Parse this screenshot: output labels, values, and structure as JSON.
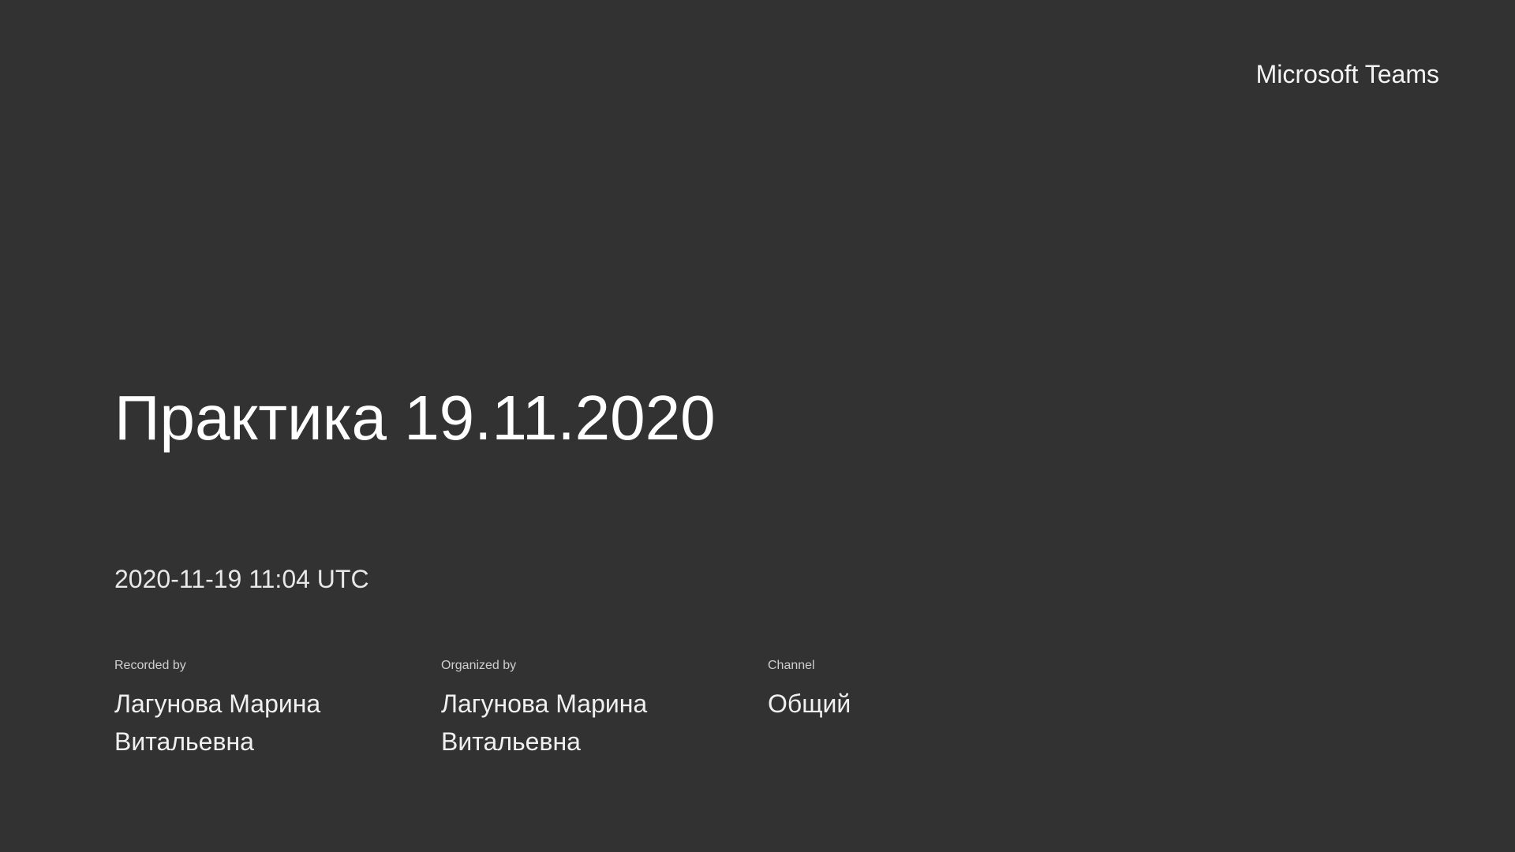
{
  "brand": "Microsoft Teams",
  "title": "Практика 19.11.2020",
  "datetime": "2020-11-19 11:04 UTC",
  "meta": {
    "recorded_by": {
      "label": "Recorded by",
      "value": "Лагунова Марина Витальевна"
    },
    "organized_by": {
      "label": "Organized by",
      "value": "Лагунова Марина Витальевна"
    },
    "channel": {
      "label": "Channel",
      "value": "Общий"
    }
  },
  "colors": {
    "background": "#323232",
    "text": "#ffffff"
  }
}
